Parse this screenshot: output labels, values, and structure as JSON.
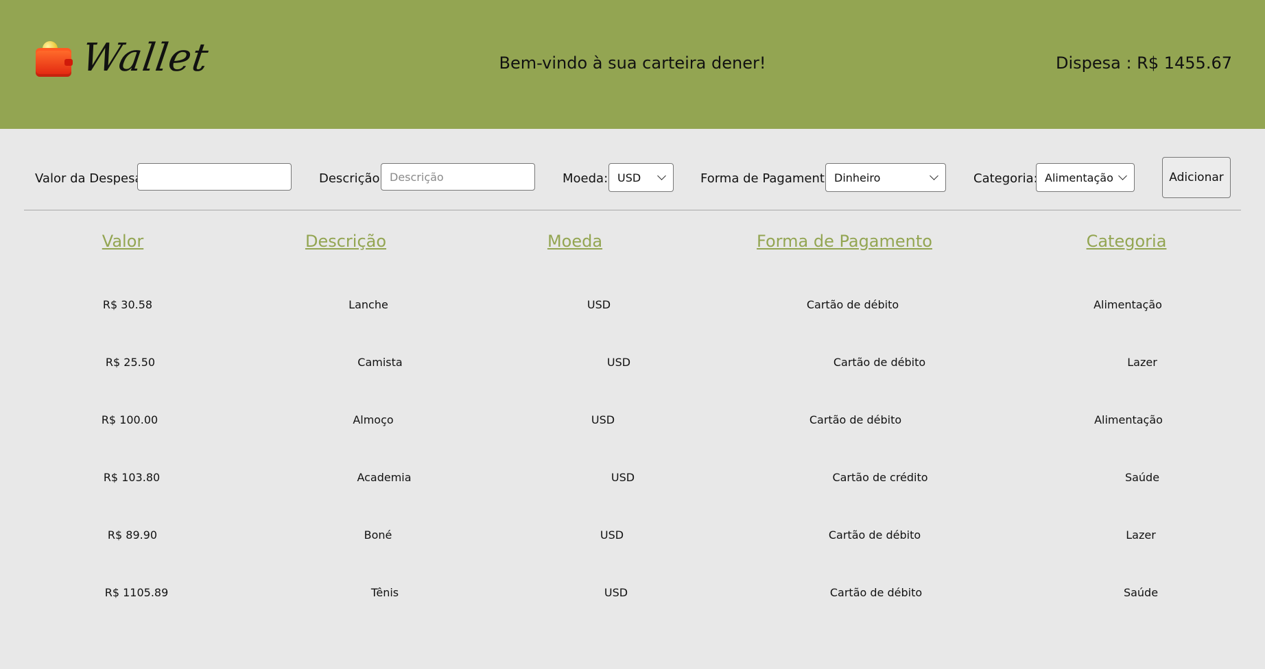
{
  "header": {
    "logo_text": "Wallet",
    "welcome": "Bem-vindo à sua carteira dener!",
    "total": "Dispesa : R$ 1455.67",
    "background": "#93a552"
  },
  "form": {
    "value_label": "Valor da Despesa:",
    "value_input": "",
    "description_label": "Descrição:",
    "description_placeholder": "Descrição",
    "currency_label": "Moeda:",
    "currency_selected": "USD",
    "payment_label": "Forma de Pagamento:",
    "payment_selected": "Dinheiro",
    "category_label": "Categoria:",
    "category_selected": "Alimentação",
    "add_button": "Adicionar"
  },
  "table": {
    "headers": [
      "Valor",
      "Descrição",
      "Moeda",
      "Forma de Pagamento",
      "Categoria"
    ],
    "header_color": "#93a552",
    "rows": [
      [
        "R$ 30.58",
        "Lanche",
        "USD",
        "Cartão de débito",
        "Alimentação"
      ],
      [
        "R$ 25.50",
        "Camista",
        "USD",
        "Cartão de débito",
        "Lazer"
      ],
      [
        "R$ 100.00",
        "Almoço",
        "USD",
        "Cartão de débito",
        "Alimentação"
      ],
      [
        "R$ 103.80",
        "Academia",
        "USD",
        "Cartão de crédito",
        "Saúde"
      ],
      [
        "R$ 89.90",
        "Boné",
        "USD",
        "Cartão de débito",
        "Lazer"
      ],
      [
        "R$ 1105.89",
        "Tênis",
        "USD",
        "Cartão de débito",
        "Saúde"
      ]
    ]
  }
}
